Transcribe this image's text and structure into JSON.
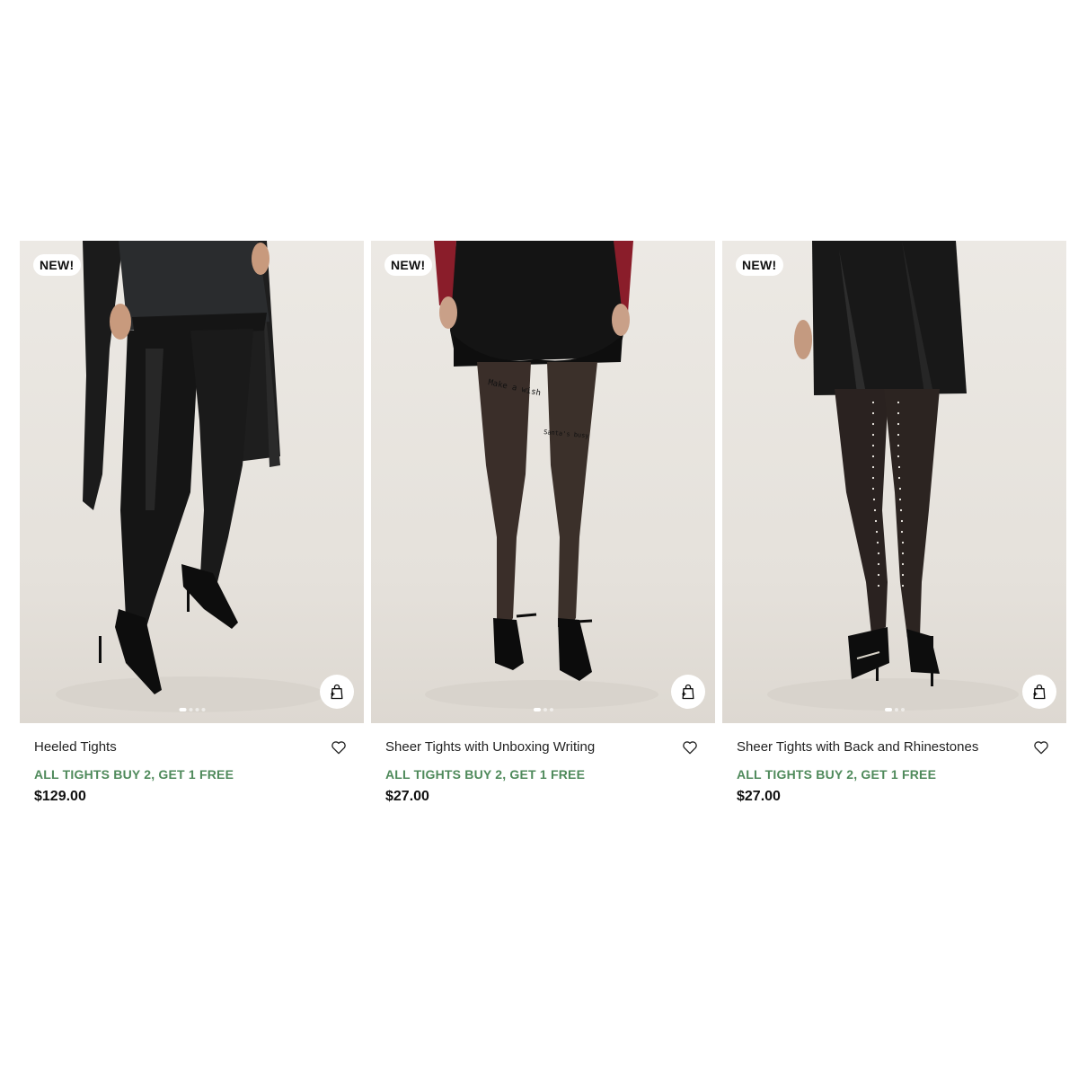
{
  "colors": {
    "promo": "#4f8a5b",
    "price": "#111111",
    "image_background": "#e8e4de"
  },
  "products": [
    {
      "badge": "NEW!",
      "name": "Heeled Tights",
      "promo": "ALL TIGHTS BUY 2, GET 1 FREE",
      "price": "$129.00",
      "icons": [
        "shopping-bag-plus-icon",
        "heart-icon"
      ],
      "carousel_dots": 4,
      "carousel_active": 1
    },
    {
      "badge": "NEW!",
      "name": "Sheer Tights with Unboxing Writing",
      "promo": "ALL TIGHTS BUY 2, GET 1 FREE",
      "price": "$27.00",
      "icons": [
        "shopping-bag-plus-icon",
        "heart-icon"
      ],
      "carousel_dots": 3,
      "carousel_active": 1
    },
    {
      "badge": "NEW!",
      "name": "Sheer Tights with Back and Rhinestones",
      "promo": "ALL TIGHTS BUY 2, GET 1 FREE",
      "price": "$27.00",
      "icons": [
        "shopping-bag-plus-icon",
        "heart-icon"
      ],
      "carousel_dots": 3,
      "carousel_active": 1
    }
  ]
}
